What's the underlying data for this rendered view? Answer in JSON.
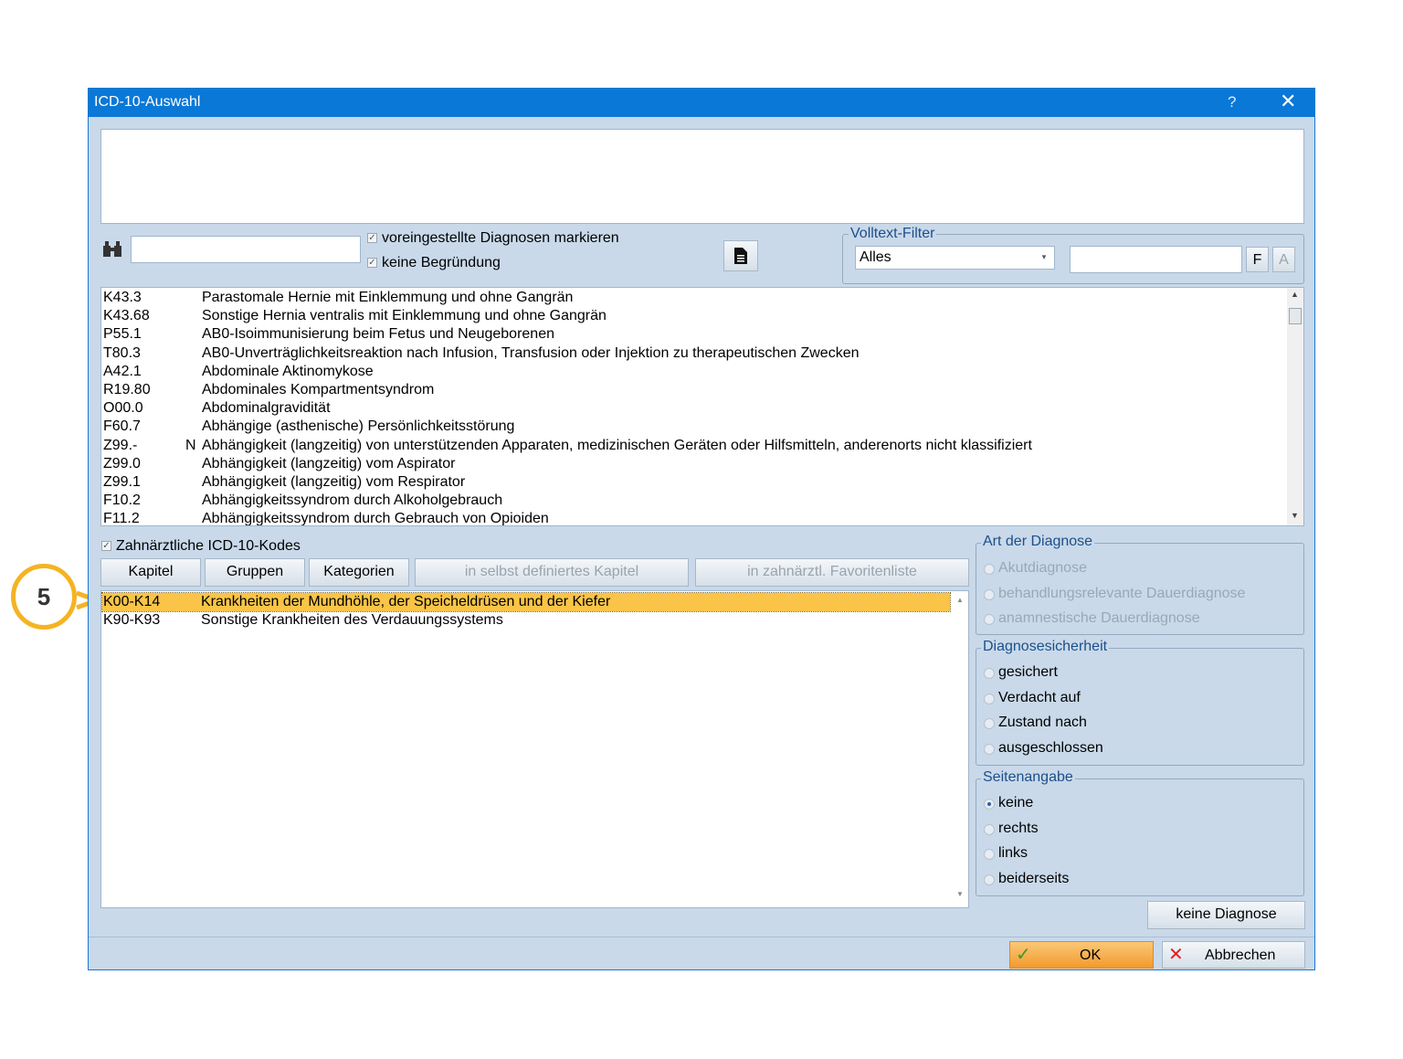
{
  "window": {
    "title": "ICD-10-Auswahl",
    "help_glyph": "?",
    "close_glyph": "✕"
  },
  "search": {
    "value": "",
    "checkbox_preset_label": "voreingestellte Diagnosen markieren",
    "checkbox_no_reason_label": "keine Begründung"
  },
  "fulltext_filter": {
    "label": "Volltext-Filter",
    "select_value": "Alles",
    "input_value": "",
    "button_f": "F",
    "button_a": "A"
  },
  "icd_list": [
    {
      "code": "K43.3",
      "mark": "",
      "desc": "Parastomale Hernie mit Einklemmung und ohne Gangrän"
    },
    {
      "code": "K43.68",
      "mark": "",
      "desc": "Sonstige Hernia ventralis mit Einklemmung und ohne Gangrän"
    },
    {
      "code": "P55.1",
      "mark": "",
      "desc": "AB0-Isoimmunisierung beim Fetus und Neugeborenen"
    },
    {
      "code": "T80.3",
      "mark": "",
      "desc": "AB0-Unverträglichkeitsreaktion nach Infusion, Transfusion oder Injektion zu therapeutischen Zwecken"
    },
    {
      "code": "A42.1",
      "mark": "",
      "desc": "Abdominale Aktinomykose"
    },
    {
      "code": "R19.80",
      "mark": "",
      "desc": "Abdominales Kompartmentsyndrom"
    },
    {
      "code": "O00.0",
      "mark": "",
      "desc": "Abdominalgravidität"
    },
    {
      "code": "F60.7",
      "mark": "",
      "desc": "Abhängige (asthenische) Persönlichkeitsstörung"
    },
    {
      "code": "Z99.-",
      "mark": "N",
      "desc": "Abhängigkeit (langzeitig) von unterstützenden Apparaten, medizinischen Geräten oder Hilfsmitteln, anderenorts nicht klassifiziert"
    },
    {
      "code": "Z99.0",
      "mark": "",
      "desc": "Abhängigkeit (langzeitig) vom Aspirator"
    },
    {
      "code": "Z99.1",
      "mark": "",
      "desc": "Abhängigkeit (langzeitig) vom Respirator"
    },
    {
      "code": "F10.2",
      "mark": "",
      "desc": "Abhängigkeitssyndrom durch Alkoholgebrauch"
    },
    {
      "code": "F11.2",
      "mark": "",
      "desc": "Abhängigkeitssyndrom durch Gebrauch von Opioiden"
    }
  ],
  "dental": {
    "checkbox_label": "Zahnärztliche ICD-10-Kodes",
    "buttons": {
      "kapitel": "Kapitel",
      "gruppen": "Gruppen",
      "kategorien": "Kategorien",
      "custom_chapter": "in selbst definiertes Kapitel",
      "favorites": "in zahnärztl. Favoritenliste"
    },
    "list": [
      {
        "code": "K00-K14",
        "desc": "Krankheiten der Mundhöhle, der Speicheldrüsen und der Kiefer",
        "selected": true
      },
      {
        "code": "K90-K93",
        "desc": "Sonstige Krankheiten des Verdauungssystems",
        "selected": false
      }
    ]
  },
  "art_der_diagnose": {
    "label": "Art der Diagnose",
    "options": [
      "Akutdiagnose",
      "behandlungsrelevante Dauerdiagnose",
      "anamnestische Dauerdiagnose"
    ]
  },
  "diagnosesicherheit": {
    "label": "Diagnosesicherheit",
    "options": [
      "gesichert",
      "Verdacht auf",
      "Zustand nach",
      "ausgeschlossen"
    ]
  },
  "seitenangabe": {
    "label": "Seitenangabe",
    "options": [
      "keine",
      "rechts",
      "links",
      "beiderseits"
    ],
    "selected": "keine"
  },
  "buttons": {
    "keine_diagnose": "keine Diagnose",
    "ok": "OK",
    "abbrechen": "Abbrechen"
  },
  "callout": {
    "number": "5",
    "color": "#f5b324"
  },
  "colors": {
    "titlebar": "#0a78d7",
    "dialog_bg": "#c9d9ea",
    "selection": "#f9c447",
    "ok_button": "#f7b04b"
  }
}
